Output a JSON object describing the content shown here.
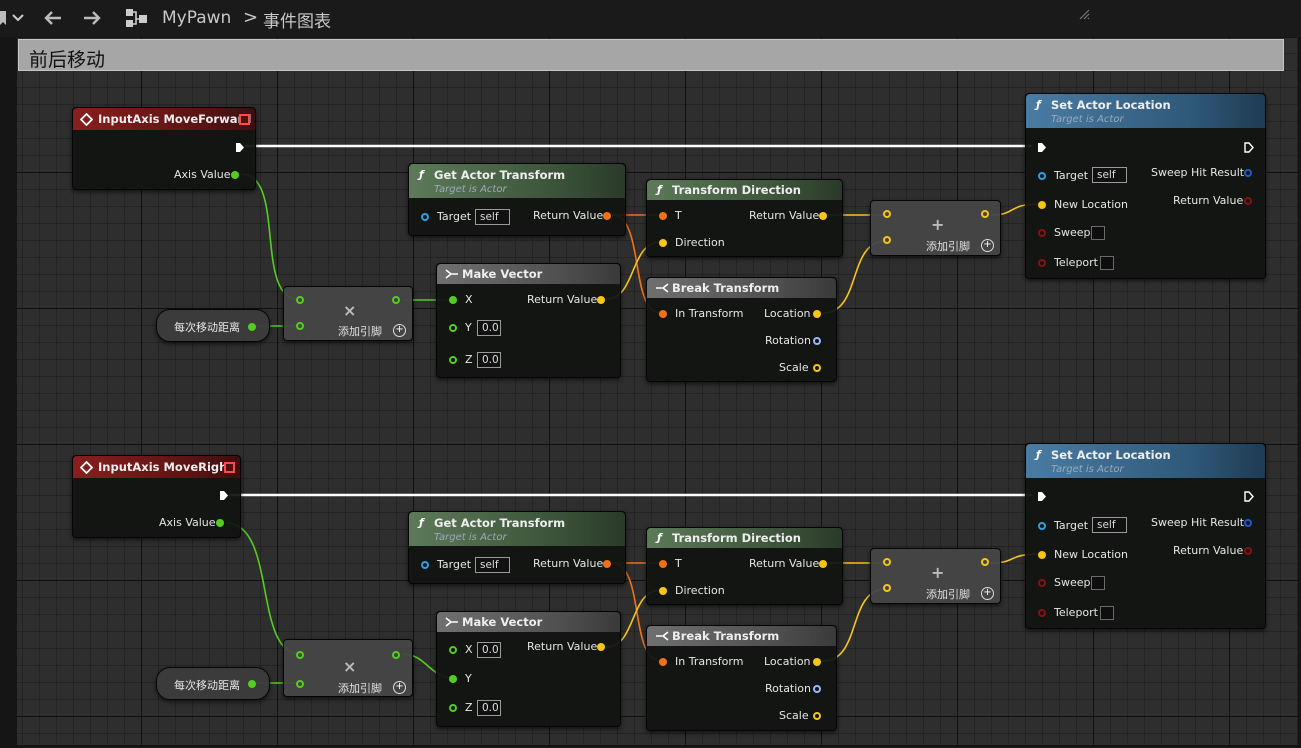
{
  "toolbar": {
    "breadcrumb_root": "MyPawn",
    "breadcrumb_separator": ">",
    "breadcrumb_current": "事件图表"
  },
  "comment": {
    "title": "前后移动"
  },
  "colors": {
    "exec": "#ffffff",
    "float": "#55cc22",
    "vector": "#f5c518",
    "transform": "#f07018",
    "object": "#2aa0e8",
    "rotator": "#9ab8ff",
    "struct": "#1e5ac8",
    "bool": "#8a1010"
  },
  "graph": [
    {
      "input_axis": {
        "title": "InputAxis MoveForward",
        "axis_value_label": "Axis Value"
      },
      "variable": {
        "label": "每次移动距离"
      },
      "multiply": {
        "symbol": "×",
        "add_pin_label": "添加引脚"
      },
      "get_actor_transform": {
        "title": "Get Actor Transform",
        "subtitle": "Target is Actor",
        "target_label": "Target",
        "target_value": "self",
        "return_label": "Return Value"
      },
      "make_vector": {
        "title": "Make Vector",
        "x_label": "X",
        "y_label": "Y",
        "z_label": "Z",
        "y_value": "0.0",
        "z_value": "0.0",
        "return_label": "Return Value"
      },
      "transform_direction": {
        "title": "Transform Direction",
        "t_label": "T",
        "direction_label": "Direction",
        "return_label": "Return Value"
      },
      "break_transform": {
        "title": "Break Transform",
        "in_label": "In Transform",
        "location_label": "Location",
        "rotation_label": "Rotation",
        "scale_label": "Scale"
      },
      "add": {
        "symbol": "+",
        "add_pin_label": "添加引脚"
      },
      "set_actor_location": {
        "title": "Set Actor Location",
        "subtitle": "Target is Actor",
        "target_label": "Target",
        "target_value": "self",
        "new_location_label": "New Location",
        "sweep_label": "Sweep",
        "teleport_label": "Teleport",
        "sweep_hit_label": "Sweep Hit Result",
        "return_label": "Return Value"
      }
    },
    {
      "input_axis": {
        "title": "InputAxis MoveRight",
        "axis_value_label": "Axis Value"
      },
      "variable": {
        "label": "每次移动距离"
      },
      "multiply": {
        "symbol": "×",
        "add_pin_label": "添加引脚"
      },
      "get_actor_transform": {
        "title": "Get Actor Transform",
        "subtitle": "Target is Actor",
        "target_label": "Target",
        "target_value": "self",
        "return_label": "Return Value"
      },
      "make_vector": {
        "title": "Make Vector",
        "x_label": "X",
        "y_label": "Y",
        "z_label": "Z",
        "x_value": "0.0",
        "z_value": "0.0",
        "return_label": "Return Value"
      },
      "transform_direction": {
        "title": "Transform Direction",
        "t_label": "T",
        "direction_label": "Direction",
        "return_label": "Return Value"
      },
      "break_transform": {
        "title": "Break Transform",
        "in_label": "In Transform",
        "location_label": "Location",
        "rotation_label": "Rotation",
        "scale_label": "Scale"
      },
      "add": {
        "symbol": "+",
        "add_pin_label": "添加引脚"
      },
      "set_actor_location": {
        "title": "Set Actor Location",
        "subtitle": "Target is Actor",
        "target_label": "Target",
        "target_value": "self",
        "new_location_label": "New Location",
        "sweep_label": "Sweep",
        "teleport_label": "Teleport",
        "sweep_hit_label": "Sweep Hit Result",
        "return_label": "Return Value"
      }
    }
  ]
}
